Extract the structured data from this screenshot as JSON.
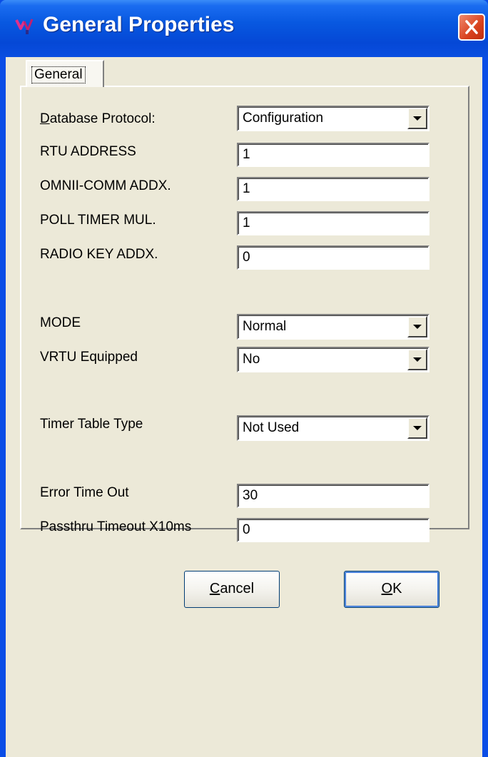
{
  "window": {
    "title": "General Properties",
    "icons": {
      "app": "properties-app-icon",
      "close": "close-icon"
    },
    "colors": {
      "titlebar": "#0548d6",
      "close": "#d8421e",
      "face": "#ece9d8"
    }
  },
  "tabs": [
    {
      "label": "General",
      "selected": true
    }
  ],
  "form": {
    "database_protocol": {
      "label": "Database Protocol:",
      "value": "Configuration"
    },
    "rtu_address": {
      "label": "RTU ADDRESS",
      "value": "1"
    },
    "omnii_comm_addx": {
      "label": "OMNII-COMM ADDX.",
      "value": "1"
    },
    "poll_timer_mul": {
      "label": "POLL TIMER MUL.",
      "value": "1"
    },
    "radio_key_addx": {
      "label": "RADIO KEY ADDX.",
      "value": "0"
    },
    "mode": {
      "label": "MODE",
      "value": "Normal"
    },
    "vrtu_equipped": {
      "label": "VRTU Equipped",
      "value": "No"
    },
    "timer_table_type": {
      "label": "Timer Table Type",
      "value": "Not Used"
    },
    "error_time_out": {
      "label": "Error Time Out",
      "value": "30"
    },
    "passthru_timeout": {
      "label": "Passthru Timeout X10ms",
      "value": "0"
    }
  },
  "buttons": {
    "cancel": "Cancel",
    "ok": "OK"
  }
}
